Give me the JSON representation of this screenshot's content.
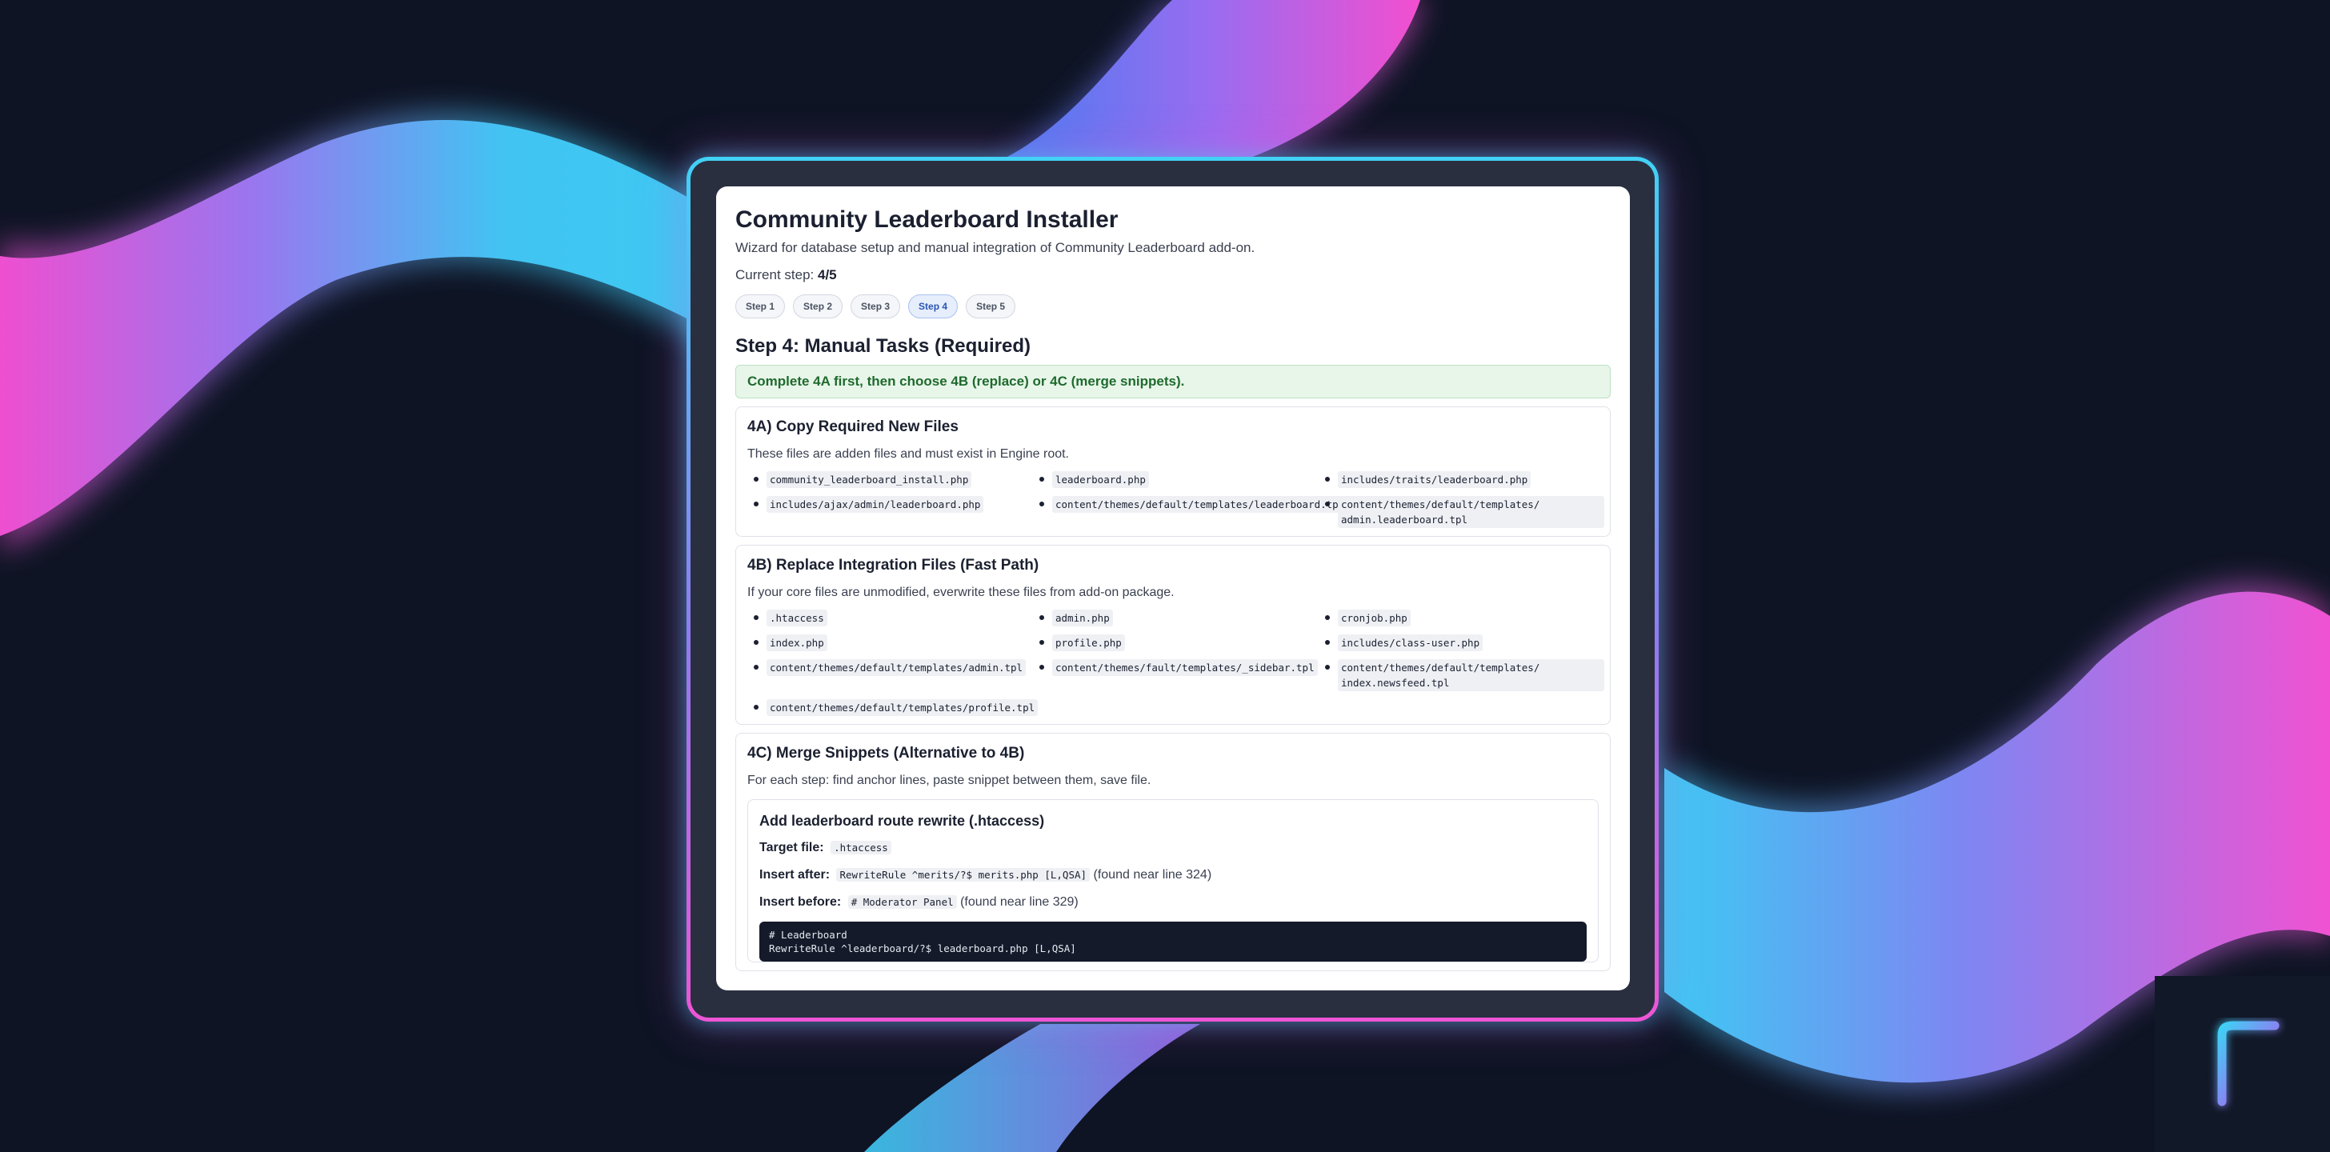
{
  "colors": {
    "background": "#0e1424",
    "wave_cyan": "#3ec9f3",
    "wave_violet": "#8f7cf2",
    "wave_pink": "#ef4fd2",
    "notice_green": "#e8f6ea",
    "active_step": "#2b55b5"
  },
  "app": {
    "title": "Community Leaderboard Installer",
    "subtitle": "Wizard for database setup and manual integration of Community Leaderboard add-on.",
    "current_step_label": "Current step:",
    "current_step_value": "4/5"
  },
  "steps": [
    {
      "label": "Step 1",
      "active": false
    },
    {
      "label": "Step 2",
      "active": false
    },
    {
      "label": "Step 3",
      "active": false
    },
    {
      "label": "Step 4",
      "active": true
    },
    {
      "label": "Step 5",
      "active": false
    }
  ],
  "section": {
    "title": "Step 4: Manual Tasks (Required)",
    "notice": "Complete 4A first, then choose 4B (replace) or 4C (merge snippets)."
  },
  "card_4a": {
    "title": "4A) Copy Required New Files",
    "description": "These files are adden files and must exist in Engine root.",
    "files": [
      "community_leaderboard_install.php",
      "leaderboard.php",
      "includes/traits/leaderboard.php",
      "includes/ajax/admin/leaderboard.php",
      "content/themes/default/templates/leaderboard.tpl",
      "content/themes/default/templates/ admin.leaderboard.tpl"
    ]
  },
  "card_4b": {
    "title": "4B) Replace Integration Files (Fast Path)",
    "description": "If your core files are unmodified, everwrite these files from add-on package.",
    "files": [
      ".htaccess",
      "admin.php",
      "cronjob.php",
      "index.php",
      "profile.php",
      "includes/class-user.php",
      "content/themes/default/templates/admin.tpl",
      "content/themes/fault/templates/_sidebar.tpl",
      "content/themes/default/templates/ index.newsfeed.tpl",
      "content/themes/default/templates/profile.tpl"
    ]
  },
  "card_4c": {
    "title": "4C) Merge Snippets (Alternative to 4B)",
    "description": "For each step: find anchor lines, paste snippet between them, save file.",
    "snippet": {
      "title": "Add leaderboard route rewrite (.htaccess)",
      "target_label": "Target file:",
      "target_value": ".htaccess",
      "after_label": "Insert after:",
      "after_value": "RewriteRule ^merits/?$ merits.php [L,QSA]",
      "after_note": "(found near line 324)",
      "before_label": "Insert before:",
      "before_value": "# Moderator Panel",
      "before_note": "(found near line 329)",
      "code_lines": [
        "# Leaderboard",
        "RewriteRule ^leaderboard/?$ leaderboard.php [L,QSA]"
      ]
    }
  },
  "brand": {
    "logo_icon": "F-letter-logo-icon"
  }
}
